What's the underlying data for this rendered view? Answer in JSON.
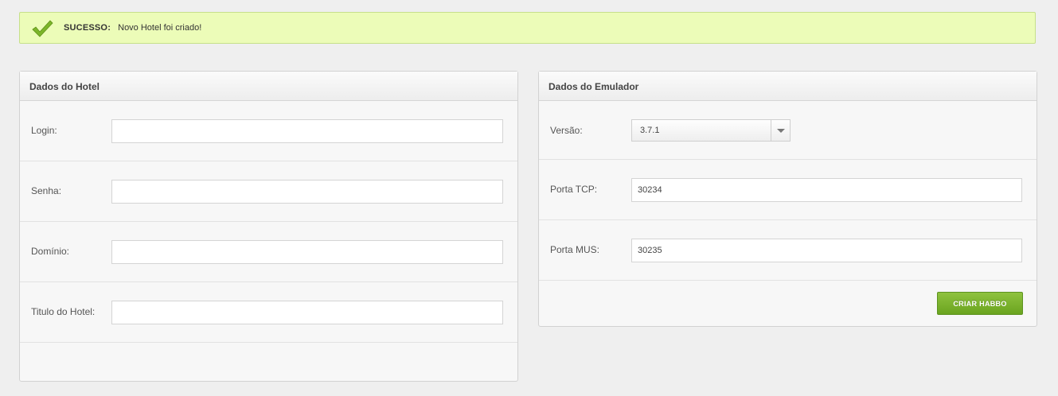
{
  "alert": {
    "icon": "checkmark-icon",
    "title": "SUCESSO:",
    "message": "Novo Hotel foi criado!",
    "color": "#ecfcb8"
  },
  "hotel": {
    "title": "Dados do Hotel",
    "fields": [
      {
        "label": "Login:",
        "value": ""
      },
      {
        "label": "Senha:",
        "value": ""
      },
      {
        "label": "Domínio:",
        "value": ""
      },
      {
        "label": "Titulo do Hotel:",
        "value": ""
      }
    ]
  },
  "emulator": {
    "title": "Dados do Emulador",
    "version": {
      "label": "Versão:",
      "selected": "3.7.1"
    },
    "tcp": {
      "label": "Porta TCP:",
      "value": "30234"
    },
    "mus": {
      "label": "Porta MUS:",
      "value": "30235"
    },
    "submit_label": "CRIAR HABBO",
    "accent": "#78b02a"
  }
}
